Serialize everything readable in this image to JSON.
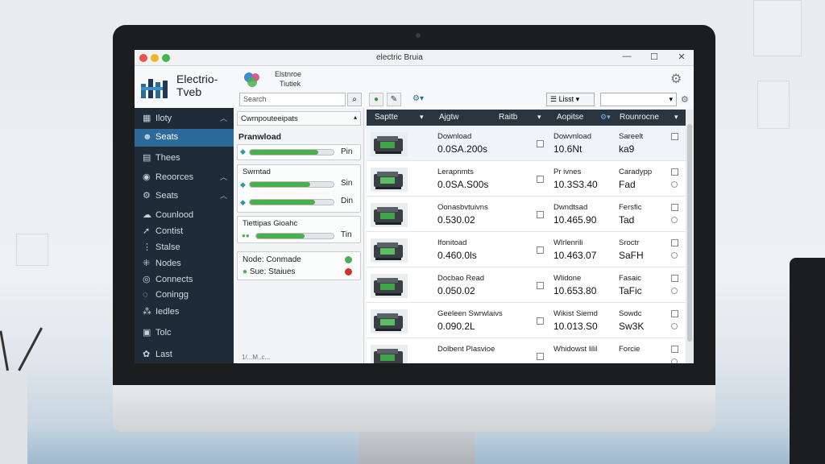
{
  "window": {
    "title": "electric Bruia",
    "controls": [
      "—",
      "☐",
      "✕"
    ]
  },
  "logo": {
    "line1": "Electrio-",
    "line2": "Tveb"
  },
  "app": {
    "line1": "Elstnroe",
    "line2": "Tiutiek"
  },
  "search": {
    "placeholder": "Search"
  },
  "toolbar": {
    "list_label": "Lisst"
  },
  "sidebar": {
    "items": [
      {
        "label": "Iloty",
        "icon": "grid-icon"
      },
      {
        "label": "Seats",
        "icon": "people-icon"
      },
      {
        "label": "Thees",
        "icon": "layers-icon"
      },
      {
        "label": "Reoorces",
        "icon": "pin-icon"
      },
      {
        "label": "Seats",
        "icon": "gear-icon"
      },
      {
        "label": "Counlood",
        "icon": "cloud-icon"
      },
      {
        "label": "Contist",
        "icon": "arrow-icon"
      },
      {
        "label": "Stalse",
        "icon": "sliders-icon"
      },
      {
        "label": "Nodes",
        "icon": "nodes-icon"
      },
      {
        "label": "Connects",
        "icon": "connect-icon"
      },
      {
        "label": "Coningg",
        "icon": "config-icon"
      },
      {
        "label": "Iedles",
        "icon": "tune-icon"
      },
      {
        "label": "Tolc",
        "icon": "lock-icon"
      },
      {
        "label": "Last",
        "icon": "settings-icon"
      }
    ]
  },
  "midpanel": {
    "header": "Cwmpouteeipats",
    "download_title": "Pranwload",
    "download_value": "Pin",
    "download_progress": 0.82,
    "section2_title": "Swrntad",
    "bar2_value": "Sin",
    "bar2_progress": 0.72,
    "bar3_value": "Din",
    "bar3_progress": 0.78,
    "section3_title": "Tiettipas Gioahc",
    "bar4_value": "Tin",
    "bar4_progress": 0.62,
    "status_line1": "Node: Conmade",
    "status_line2": "Sue: Staiues",
    "status_colors": [
      "#4caf50",
      "#d32f2f"
    ],
    "footer": "1/...M..c..."
  },
  "table": {
    "headers": [
      "Saptte",
      "Ajgtw",
      "Raitb",
      "Aopitse",
      "Rounrocne"
    ],
    "rows": [
      {
        "c1a": "Download",
        "c1b": "0.0SA.200s",
        "c2a": "Dowvnload",
        "c2b": "10.6Nt",
        "c3a": "Sareelt",
        "c3b": "ka9"
      },
      {
        "c1a": "Lerapnmts",
        "c1b": "0.0SA.S00s",
        "c2a": "Pr ivnes",
        "c2b": "10.3S3.40",
        "c3a": "Caradypp",
        "c3b": "Fad"
      },
      {
        "c1a": "Oonasbvtuivns",
        "c1b": "0.530.02",
        "c2a": "Dwndtsad",
        "c2b": "10.465.90",
        "c3a": "Fersfic",
        "c3b": "Tad"
      },
      {
        "c1a": "Ifonitoad",
        "c1b": "0.460.0ls",
        "c2a": "Wlrlenrili",
        "c2b": "10.463.07",
        "c3a": "Sroctr",
        "c3b": "SaFH"
      },
      {
        "c1a": "Docbao Read",
        "c1b": "0.050.02",
        "c2a": "Wlidone",
        "c2b": "10.653.80",
        "c3a": "Fasaic",
        "c3b": "TaFic"
      },
      {
        "c1a": "Geeleen Swrwlaivs",
        "c1b": "0.090.2L",
        "c2a": "Wikist Siemd",
        "c2b": "10.013.S0",
        "c3a": "Sowdc",
        "c3b": "Sw3K"
      },
      {
        "c1a": "Dolbent Plasvioe",
        "c1b": "",
        "c2a": "Whidowst lilil",
        "c2b": "",
        "c3a": "Forcie",
        "c3b": ""
      }
    ]
  }
}
